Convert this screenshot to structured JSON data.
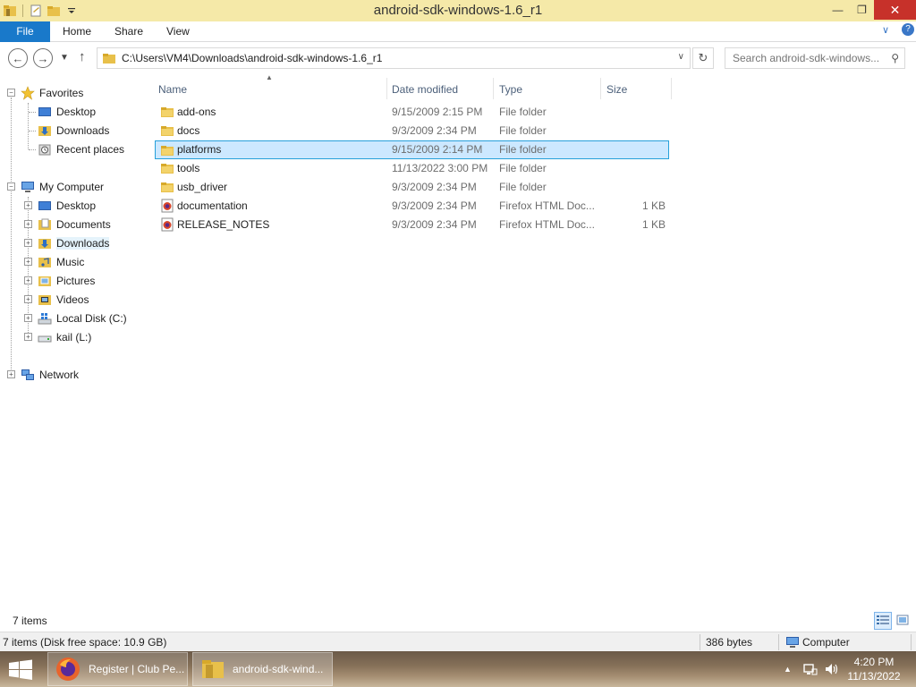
{
  "window": {
    "title": "android-sdk-windows-1.6_r1",
    "minimize": "—",
    "maximize": "❐",
    "close": "✕"
  },
  "ribbon": {
    "tabs": [
      "File",
      "Home",
      "Share",
      "View"
    ],
    "expand": "∨",
    "help": "?"
  },
  "address": {
    "path": "C:\\Users\\VM4\\Downloads\\android-sdk-windows-1.6_r1",
    "search_placeholder": "Search android-sdk-windows..."
  },
  "nav": {
    "favorites": {
      "label": "Favorites",
      "items": [
        "Desktop",
        "Downloads",
        "Recent places"
      ]
    },
    "computer": {
      "label": "My Computer",
      "items": [
        "Desktop",
        "Documents",
        "Downloads",
        "Music",
        "Pictures",
        "Videos",
        "Local Disk (C:)",
        "kail (L:)"
      ],
      "selected": "Downloads"
    },
    "network": {
      "label": "Network"
    }
  },
  "columns": {
    "name": "Name",
    "date": "Date modified",
    "type": "Type",
    "size": "Size"
  },
  "files": [
    {
      "name": "add-ons",
      "date": "9/15/2009 2:15 PM",
      "type": "File folder",
      "size": "",
      "icon": "folder-icon"
    },
    {
      "name": "docs",
      "date": "9/3/2009 2:34 PM",
      "type": "File folder",
      "size": "",
      "icon": "folder-icon"
    },
    {
      "name": "platforms",
      "date": "9/15/2009 2:14 PM",
      "type": "File folder",
      "size": "",
      "icon": "folder-icon",
      "selected": true
    },
    {
      "name": "tools",
      "date": "11/13/2022 3:00 PM",
      "type": "File folder",
      "size": "",
      "icon": "folder-icon"
    },
    {
      "name": "usb_driver",
      "date": "9/3/2009 2:34 PM",
      "type": "File folder",
      "size": "",
      "icon": "folder-icon"
    },
    {
      "name": "documentation",
      "date": "9/3/2009 2:34 PM",
      "type": "Firefox HTML Doc...",
      "size": "1 KB",
      "icon": "firefox-html-icon"
    },
    {
      "name": "RELEASE_NOTES",
      "date": "9/3/2009 2:34 PM",
      "type": "Firefox HTML Doc...",
      "size": "1 KB",
      "icon": "firefox-html-icon"
    }
  ],
  "status": {
    "item_count": "7 items",
    "details_left": "7 items (Disk free space: 10.9 GB)",
    "details_size": "386 bytes",
    "details_location": "Computer"
  },
  "taskbar": {
    "items": [
      {
        "label": "Register | Club Pe...",
        "icon": "firefox-icon"
      },
      {
        "label": "android-sdk-wind...",
        "icon": "explorer-folder-icon"
      }
    ],
    "time": "4:20 PM",
    "date": "11/13/2022"
  },
  "colors": {
    "titlebar": "#f5e9a8",
    "file_tab": "#1979ca",
    "selection_fill": "#cce8ff",
    "selection_border": "#26a0da",
    "close_button": "#c7312a"
  }
}
